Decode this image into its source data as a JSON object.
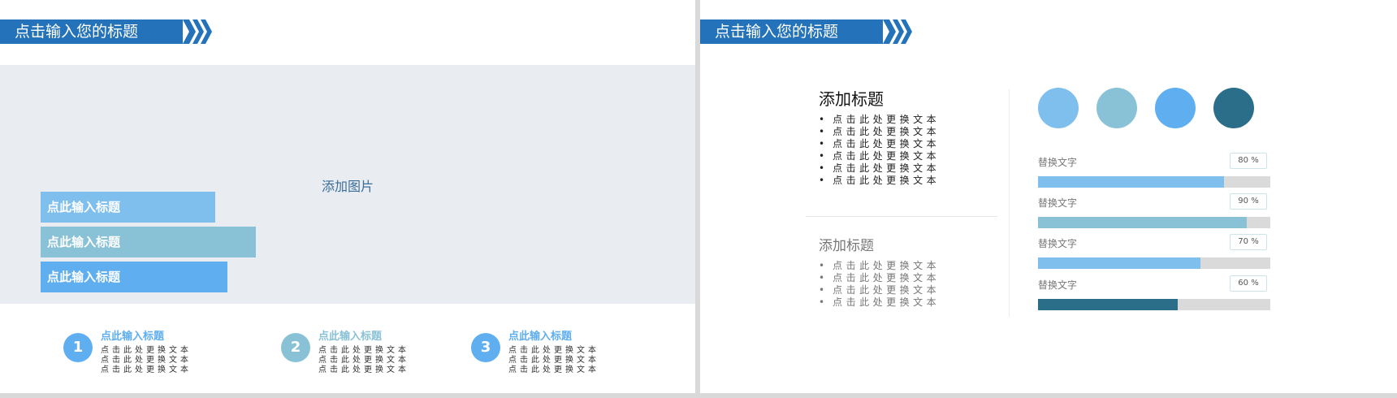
{
  "left_slide": {
    "title": "点击输入您的标题",
    "photo_placeholder": "添加图片",
    "tags": [
      {
        "label": "点此输入标题",
        "color": "#7fbfee"
      },
      {
        "label": "点此输入标题",
        "color": "#89c2d6"
      },
      {
        "label": "点此输入标题",
        "color": "#5eaef0"
      }
    ],
    "steps": [
      {
        "number": "1",
        "title": "点此输入标题",
        "color": "#5eaef0",
        "lines": [
          "点击此处更换文本",
          "点击此处更换文本",
          "点击此处更换文本"
        ]
      },
      {
        "number": "2",
        "title": "点此输入标题",
        "color": "#89c2d6",
        "lines": [
          "点击此处更换文本",
          "点击此处更换文本",
          "点击此处更换文本"
        ]
      },
      {
        "number": "3",
        "title": "点此输入标题",
        "color": "#5eaef0",
        "lines": [
          "点击此处更换文本",
          "点击此处更换文本",
          "点击此处更换文本"
        ]
      }
    ]
  },
  "right_slide": {
    "title": "点击输入您的标题",
    "section1": {
      "title": "添加标题",
      "items": [
        "点击此处更换文本",
        "点击此处更换文本",
        "点击此处更换文本",
        "点击此处更换文本",
        "点击此处更换文本",
        "点击此处更换文本"
      ]
    },
    "section2": {
      "title": "添加标题",
      "items": [
        "点击此处更换文本",
        "点击此处更换文本",
        "点击此处更换文本",
        "点击此处更换文本"
      ]
    },
    "circle_colors": [
      "#7fbfee",
      "#89c2d6",
      "#5eaef0",
      "#2b6e89"
    ],
    "bars": [
      {
        "label": "替换文字",
        "percent": 80,
        "percent_label": "80 %",
        "color": "#7fbfee"
      },
      {
        "label": "替换文字",
        "percent": 90,
        "percent_label": "90 %",
        "color": "#89c2d6"
      },
      {
        "label": "替换文字",
        "percent": 70,
        "percent_label": "70 %",
        "color": "#7fbfee"
      },
      {
        "label": "替换文字",
        "percent": 60,
        "percent_label": "60 %",
        "color": "#2b6e89"
      }
    ]
  },
  "colors": {
    "title_bar": "#2472b9",
    "chevron": "#2472b9",
    "photo_bg": "#e9ecf0"
  }
}
